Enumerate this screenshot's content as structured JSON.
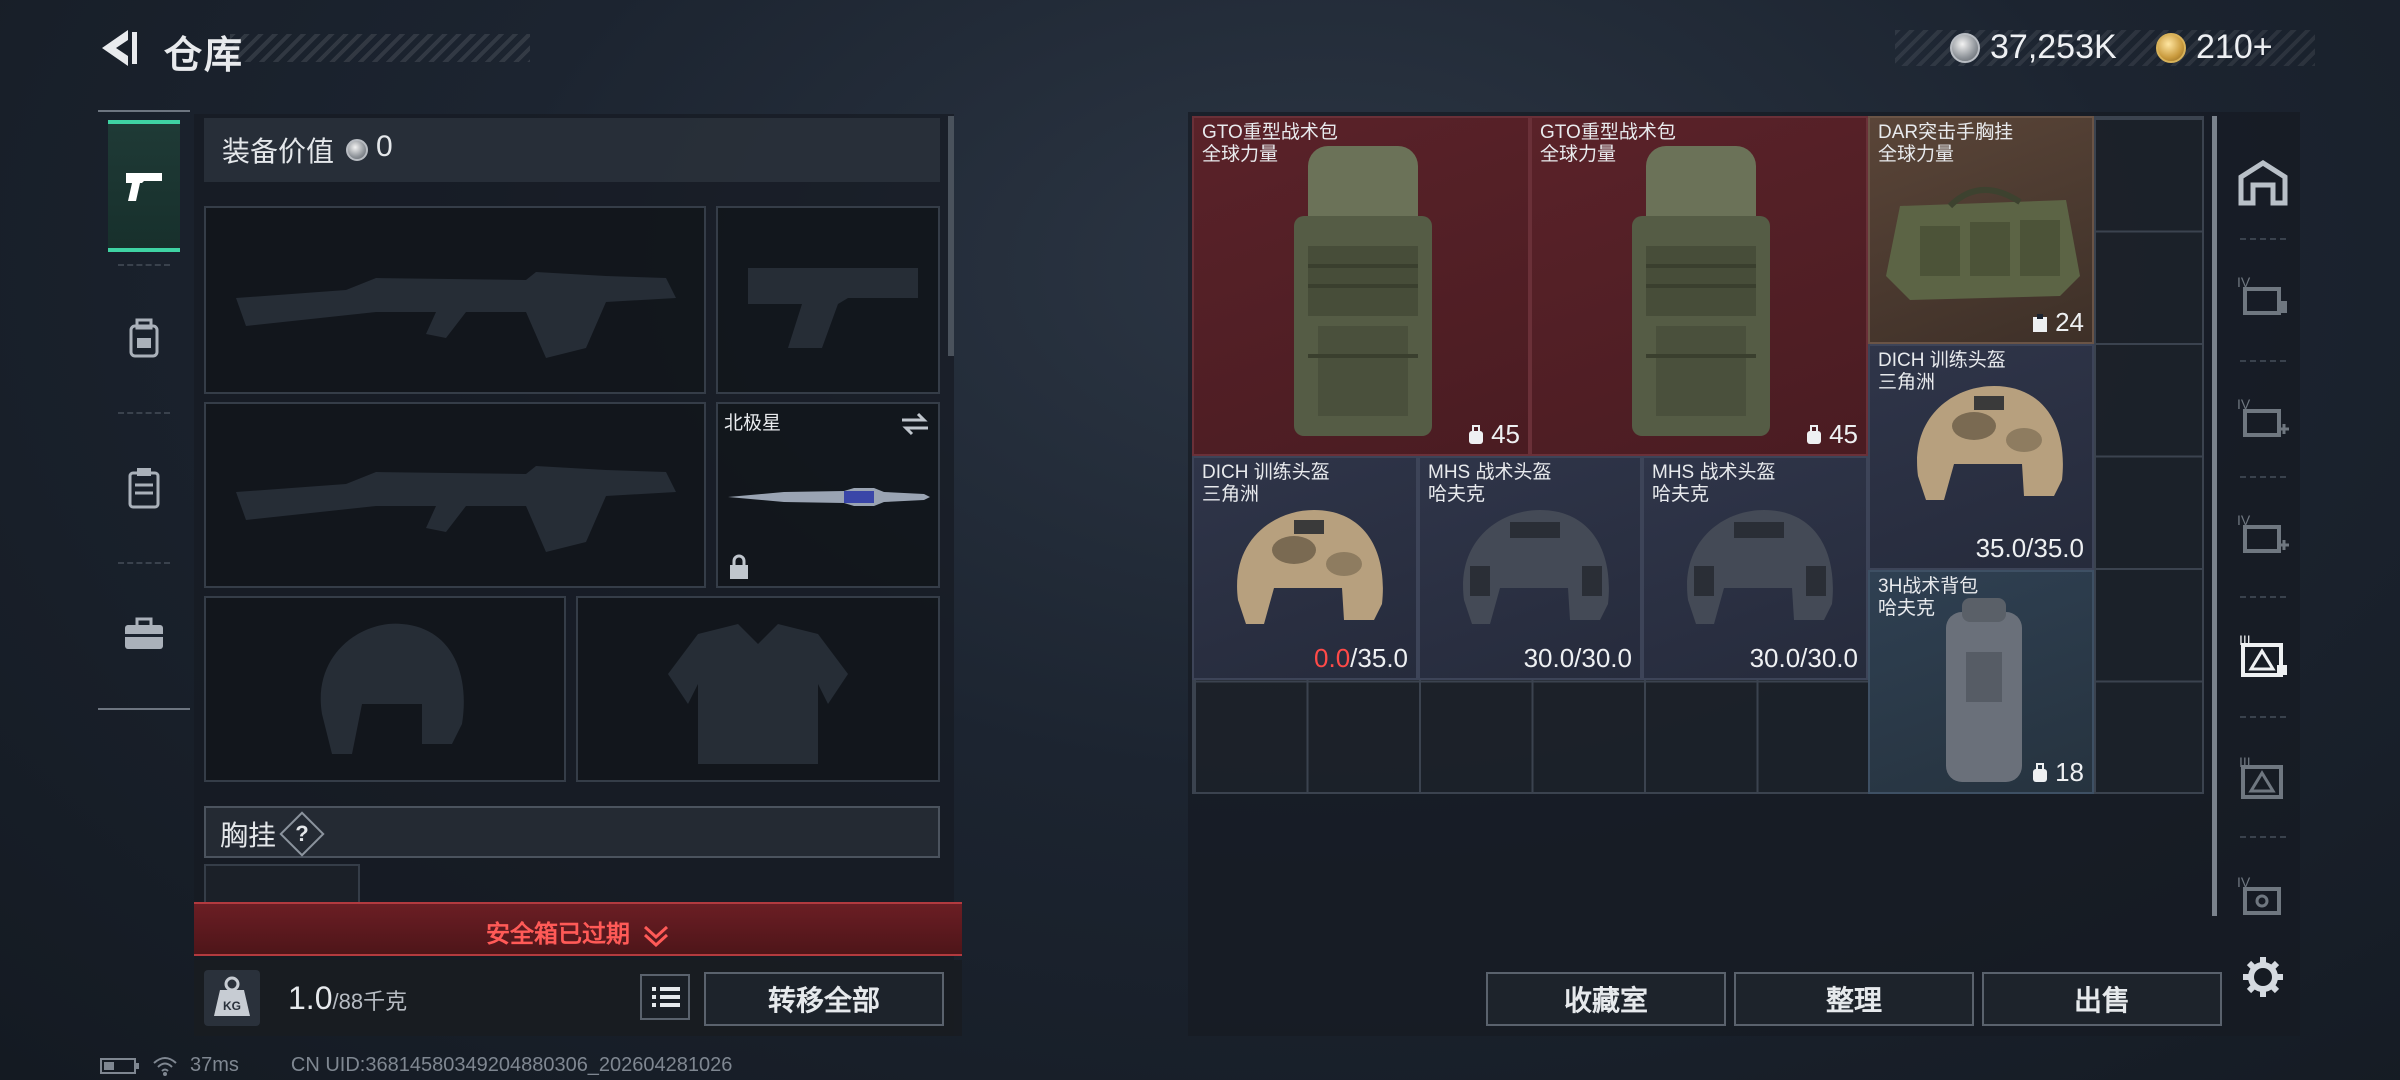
{
  "header": {
    "title": "仓库",
    "currency_silver": "37,253K",
    "currency_gold": "210+"
  },
  "equipment": {
    "value_label": "装备价值",
    "value": "0",
    "melee_name": "北极星",
    "chest_label": "胸挂",
    "chest_help": "?"
  },
  "safebox": {
    "text": "安全箱已过期"
  },
  "footer_left": {
    "weight": "1.0",
    "capacity": "/88千克",
    "weight_icon_text": "KG",
    "transfer_label": "转移全部"
  },
  "inventory": [
    {
      "name": "GTO重型战术包",
      "sub": "全球力量",
      "stat": "45",
      "stat_icon": "bag-icon",
      "color": "#5a2229"
    },
    {
      "name": "GTO重型战术包",
      "sub": "全球力量",
      "stat": "45",
      "stat_icon": "bag-icon",
      "color": "#5a2229"
    },
    {
      "name": "DAR突击手胸挂",
      "sub": "全球力量",
      "stat": "24",
      "stat_icon": "vest-icon",
      "color": "#5a4538"
    },
    {
      "name": "DICH 训练头盔",
      "sub": "三角洲",
      "stat": "35.0/35.0",
      "color": "#2f3549"
    },
    {
      "name": "DICH 训练头盔",
      "sub": "三角洲",
      "stat_current": "0.0",
      "stat_max": "/35.0",
      "color": "#2f3549"
    },
    {
      "name": "MHS 战术头盔",
      "sub": "哈夫克",
      "stat": "30.0/30.0",
      "color": "#2f3549"
    },
    {
      "name": "MHS 战术头盔",
      "sub": "哈夫克",
      "stat": "30.0/30.0",
      "color": "#2f3549"
    },
    {
      "name": "3H战术背包",
      "sub": "哈夫克",
      "stat": "18",
      "stat_icon": "bag-icon",
      "color": "#2f4052"
    }
  ],
  "buttons": {
    "collection": "收藏室",
    "organize": "整理",
    "sell": "出售"
  },
  "status_bar": {
    "ping": "37ms",
    "uid": "CN UID:3681458034920488030​6_202604281026"
  }
}
